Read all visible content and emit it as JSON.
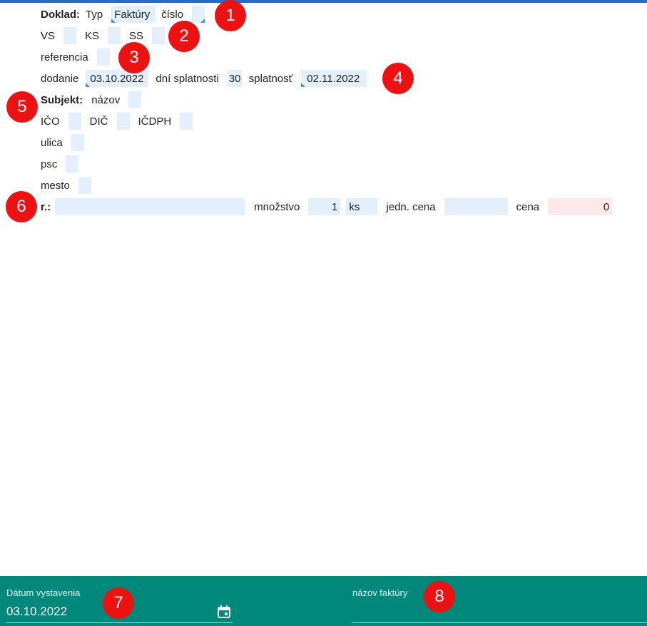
{
  "doklad": {
    "section_label": "Doklad:",
    "typ_label": "Typ",
    "typ_value": "Faktúry",
    "cislo_label": "číslo",
    "cislo_value": ""
  },
  "symbols": {
    "vs_label": "VS",
    "vs_value": "",
    "ks_label": "KS",
    "ks_value": "",
    "ss_label": "SS",
    "ss_value": ""
  },
  "referencia": {
    "label": "referencia",
    "value": ""
  },
  "dates": {
    "dodanie_label": "dodanie",
    "dodanie_value": "03.10.2022",
    "dni_label": "dní splatnosti",
    "dni_value": "30",
    "splatnost_label": "splatnosť",
    "splatnost_value": "02.11.2022"
  },
  "subjekt": {
    "section_label": "Subjekt:",
    "nazov_label": "názov",
    "nazov_value": "",
    "ico_label": "IČO",
    "ico_value": "",
    "dic_label": "DIČ",
    "dic_value": "",
    "icdph_label": "IČDPH",
    "icdph_value": "",
    "ulica_label": "ulica",
    "ulica_value": "",
    "psc_label": "psc",
    "psc_value": "",
    "mesto_label": "mesto",
    "mesto_value": ""
  },
  "item_row": {
    "r_label": "r.:",
    "r_value": "",
    "mnozstvo_label": "množstvo",
    "mnozstvo_value": "1",
    "unit_value": "ks",
    "jedn_cena_label": "jedn. cena",
    "jedn_cena_value": "",
    "cena_label": "cena",
    "cena_value": "0"
  },
  "badges": [
    "1",
    "2",
    "3",
    "4",
    "5",
    "6",
    "7",
    "8"
  ],
  "footer": {
    "datum_label": "Dátum vystavenia",
    "datum_value": "03.10.2022",
    "calendar_icon": "calendar-icon",
    "nazov_faktury_label": "názov faktúry",
    "nazov_faktury_value": ""
  },
  "colors": {
    "field_bg": "#e3f0fb",
    "cena_bg": "#fde8ea",
    "badge": "#ee1111",
    "footer_bg": "#00897b",
    "top_bar": "#1e6fd0"
  }
}
